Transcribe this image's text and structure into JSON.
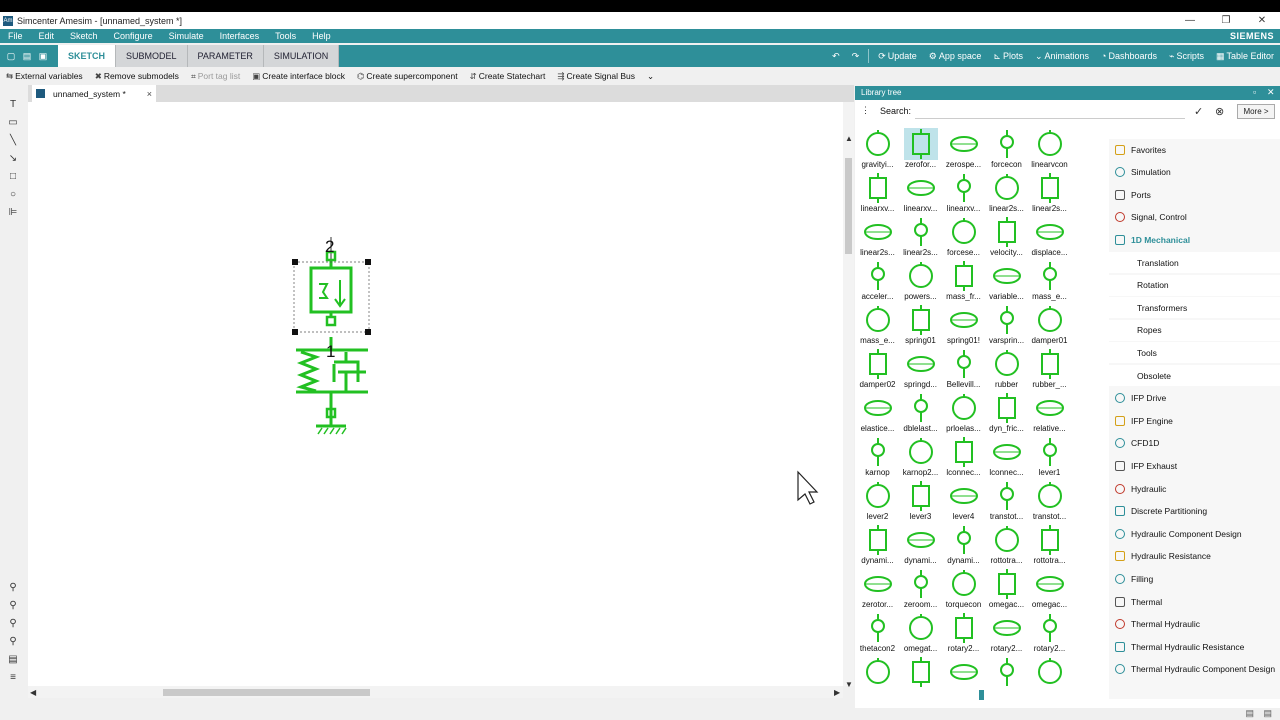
{
  "window": {
    "title": "Simcenter Amesim - [unnamed_system *]",
    "app_icon": "Am",
    "minimize": "—",
    "maximize": "❐",
    "close": "✕"
  },
  "menu": [
    "File",
    "Edit",
    "Sketch",
    "Configure",
    "Simulate",
    "Interfaces",
    "Tools",
    "Help"
  ],
  "brand": "SIEMENS",
  "mode_tabs": [
    "SKETCH",
    "SUBMODEL",
    "PARAMETER",
    "SIMULATION"
  ],
  "toolbar_right": {
    "update": "Update",
    "app_space": "App space",
    "plots": "Plots",
    "animations": "Animations",
    "dashboards": "Dashboards",
    "scripts": "Scripts",
    "table_editor": "Table Editor"
  },
  "actions": {
    "external_variables": "External variables",
    "remove_submodels": "Remove submodels",
    "port_tag_list": "Port tag list",
    "create_interface_block": "Create interface block",
    "create_supercomponent": "Create supercomponent",
    "create_statechart": "Create Statechart",
    "create_signal_bus": "Create Signal Bus"
  },
  "document_tab": {
    "name": "unnamed_system *",
    "close": "×"
  },
  "sketch": {
    "port_top": "2",
    "port_bottom": "1"
  },
  "library": {
    "title": "Library tree",
    "search_label": "Search:",
    "search_value": "",
    "more_button": "More >",
    "components": [
      [
        "gravityi...",
        "zerofor...",
        "zerospe...",
        "forcecon",
        "linearvcon"
      ],
      [
        "linearxv...",
        "linearxv...",
        "linearxv...",
        "linear2s...",
        "linear2s..."
      ],
      [
        "linear2s...",
        "linear2s...",
        "forcese...",
        "velocity...",
        "displace..."
      ],
      [
        "acceler...",
        "powers...",
        "mass_fr...",
        "variable...",
        "mass_e..."
      ],
      [
        "mass_e...",
        "spring01",
        "spring01!",
        "varsprin...",
        "damper01"
      ],
      [
        "damper02",
        "springd...",
        "Bellevill...",
        "rubber",
        "rubber_..."
      ],
      [
        "elastice...",
        "dblelast...",
        "prloelas...",
        "dyn_fric...",
        "relative..."
      ],
      [
        "karnop",
        "karnop2...",
        "lconnec...",
        "lconnec...",
        "lever1"
      ],
      [
        "lever2",
        "lever3",
        "lever4",
        "transtot...",
        "transtot..."
      ],
      [
        "dynami...",
        "dynami...",
        "dynami...",
        "rottotra...",
        "rottotra..."
      ],
      [
        "zerotor...",
        "zeroom...",
        "torquecon",
        "omegac...",
        "omegac..."
      ],
      [
        "thetacon2",
        "omegat...",
        "rotary2...",
        "rotary2...",
        "rotary2..."
      ],
      [
        "",
        "",
        "",
        "",
        ""
      ]
    ],
    "categories": [
      {
        "label": "Favorites",
        "sub": false
      },
      {
        "label": "Simulation",
        "sub": false
      },
      {
        "label": "Ports",
        "sub": false
      },
      {
        "label": "Signal, Control",
        "sub": false
      },
      {
        "label": "1D Mechanical",
        "sub": false,
        "active": true
      },
      {
        "label": "Translation",
        "sub": true
      },
      {
        "label": "Rotation",
        "sub": true
      },
      {
        "label": "Transformers",
        "sub": true
      },
      {
        "label": "Ropes",
        "sub": true
      },
      {
        "label": "Tools",
        "sub": true
      },
      {
        "label": "Obsolete",
        "sub": true
      },
      {
        "label": "IFP Drive",
        "sub": false
      },
      {
        "label": "IFP Engine",
        "sub": false
      },
      {
        "label": "CFD1D",
        "sub": false
      },
      {
        "label": "IFP Exhaust",
        "sub": false
      },
      {
        "label": "Hydraulic",
        "sub": false
      },
      {
        "label": "Discrete Partitioning",
        "sub": false
      },
      {
        "label": "Hydraulic Component Design",
        "sub": false
      },
      {
        "label": "Hydraulic Resistance",
        "sub": false
      },
      {
        "label": "Filling",
        "sub": false
      },
      {
        "label": "Thermal",
        "sub": false
      },
      {
        "label": "Thermal Hydraulic",
        "sub": false
      },
      {
        "label": "Thermal Hydraulic Resistance",
        "sub": false
      },
      {
        "label": "Thermal Hydraulic Component Design",
        "sub": false
      }
    ]
  },
  "colors": {
    "accent": "#2e8f99",
    "symbol_green": "#22c022",
    "selection": "#bfe3ea"
  }
}
